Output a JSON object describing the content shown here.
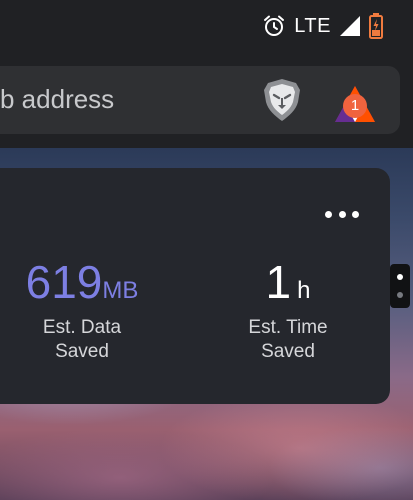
{
  "status_bar": {
    "alarm_icon": "alarm-clock-icon",
    "network_label": "LTE",
    "signal_icon": "cell-signal-icon",
    "battery_icon": "battery-charging-icon",
    "battery_color": "#f07b3f"
  },
  "toolbar": {
    "address_placeholder": "b address",
    "shield_icon": "brave-lion-icon",
    "rewards_icon": "bat-rewards-icon",
    "rewards_badge": "1",
    "badge_color": "#f0633e"
  },
  "stats_card": {
    "menu_icon": "more-horizontal-icon",
    "data_saved": {
      "value": "619",
      "unit": "MB",
      "label_line1": "Est. Data",
      "label_line2": "Saved",
      "color": "#7d7fe3"
    },
    "time_saved": {
      "value": "1",
      "unit": "h",
      "label_line1": "Est. Time",
      "label_line2": "Saved",
      "color": "#ffffff"
    }
  },
  "page_indicator": {
    "pages": 2,
    "active": 1
  }
}
